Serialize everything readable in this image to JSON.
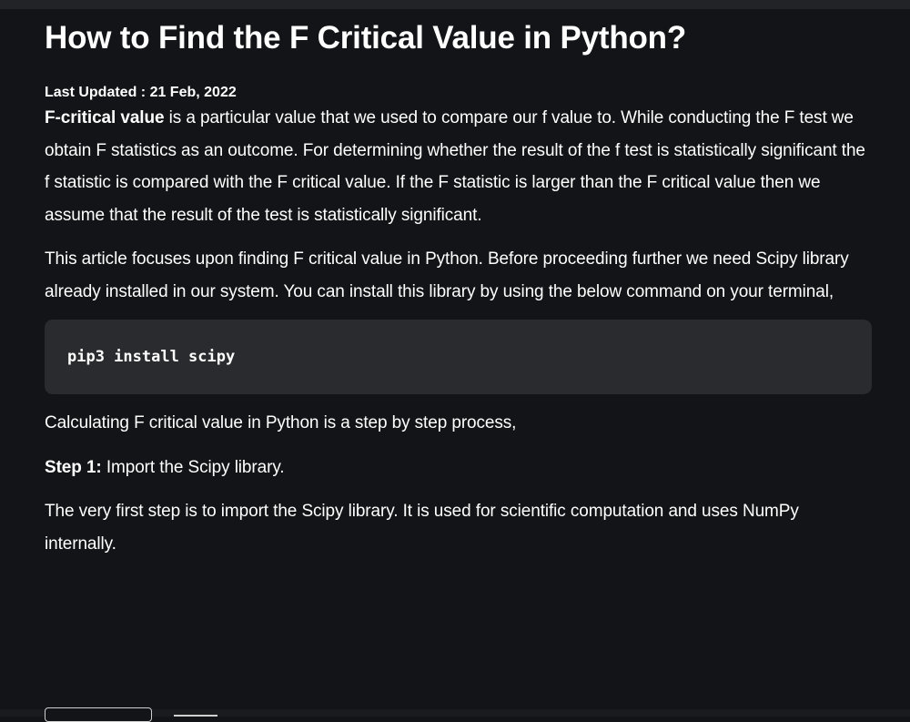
{
  "article": {
    "title": "How to Find the F Critical Value in Python?",
    "last_updated_label": "Last Updated : ",
    "last_updated_value": "21 Feb, 2022",
    "para1_bold": "F-critical value",
    "para1_text": " is a particular value that we used to compare our f value to. While conducting the F test we obtain F statistics as an outcome. For determining whether the result of the f test is statistically significant the f statistic is compared with the F critical value. If the F statistic is larger than the F critical value then we assume that the result of the test is statistically significant.",
    "para2": "This article focuses upon finding F critical value in Python. Before proceeding further we need Scipy library already installed in our system. You can install this library by using the below command on your terminal,",
    "code": "pip3 install scipy",
    "para3": "Calculating F critical value in Python is a step by step process,",
    "step1_label": "Step 1:",
    "step1_text": " Import the Scipy library.",
    "para4": "The very first step is to import the Scipy library. It is used for scientific computation and uses NumPy internally."
  },
  "colors": {
    "background": "#131417",
    "text": "#ffffff",
    "code_background": "#2a2b2e"
  }
}
